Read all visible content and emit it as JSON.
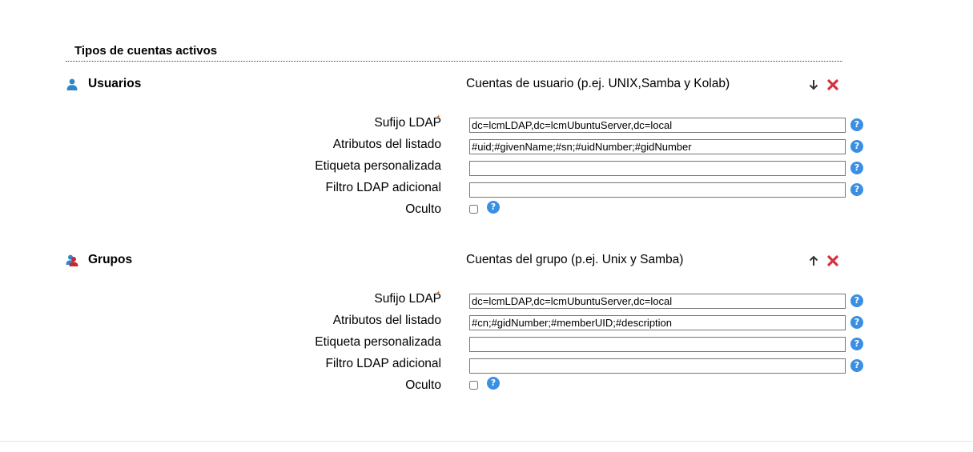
{
  "section": {
    "title": "Tipos de cuentas activos"
  },
  "types": [
    {
      "name": "Usuarios",
      "icon": "user-icon",
      "description": "Cuentas de usuario (p.ej. UNIX,Samba y Kolab)",
      "move_direction": "down",
      "fields": {
        "suffix_label": "Sufijo LDAP",
        "suffix_required_mark": "*",
        "suffix_value": "dc=lcmLDAP,dc=lcmUbuntuServer,dc=local",
        "attributes_label": "Atributos del listado",
        "attributes_value": "#uid;#givenName;#sn;#uidNumber;#gidNumber",
        "custom_label_label": "Etiqueta personalizada",
        "custom_label_value": "",
        "filter_label": "Filtro LDAP adicional",
        "filter_value": "",
        "hidden_label": "Oculto",
        "hidden_checked": false
      }
    },
    {
      "name": "Grupos",
      "icon": "group-icon",
      "description": "Cuentas del grupo (p.ej. Unix y Samba)",
      "move_direction": "up",
      "fields": {
        "suffix_label": "Sufijo LDAP",
        "suffix_required_mark": "*",
        "suffix_value": "dc=lcmLDAP,dc=lcmUbuntuServer,dc=local",
        "attributes_label": "Atributos del listado",
        "attributes_value": "#cn;#gidNumber;#memberUID;#description",
        "custom_label_label": "Etiqueta personalizada",
        "custom_label_value": "",
        "filter_label": "Filtro LDAP adicional",
        "filter_value": "",
        "hidden_label": "Oculto",
        "hidden_checked": false
      }
    }
  ],
  "help_glyph": "?",
  "colors": {
    "help_blue": "#3b8fe3",
    "remove_red": "#d6303c",
    "required_orange": "#e07020",
    "user_icon_blue": "#2f86c8"
  }
}
